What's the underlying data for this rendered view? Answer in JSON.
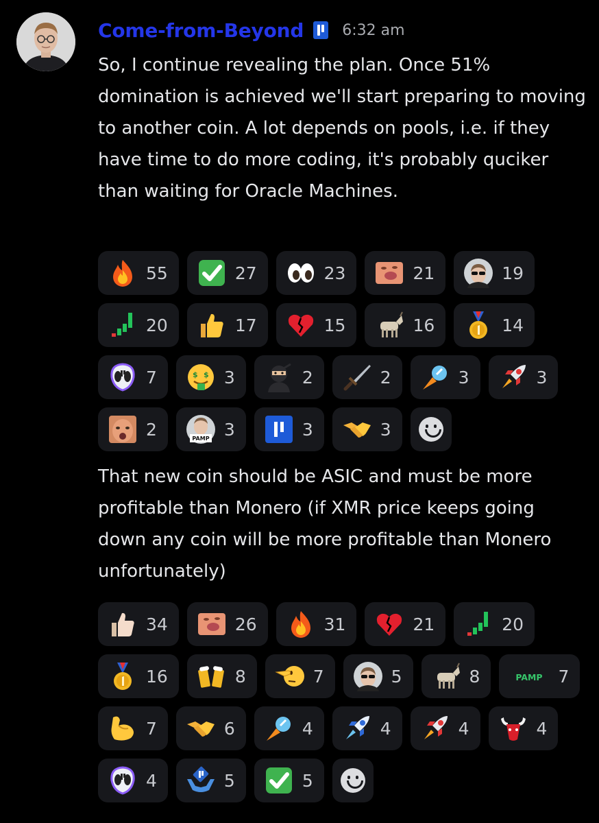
{
  "post": {
    "author": "Come-from-Beyond",
    "time": "6:32 am",
    "avatar_icon": "avatar-photo"
  },
  "message1": "So, I continue revealing the plan. Once 51% domination is achieved we'll start preparing to moving to another coin. A lot depends on pools, i.e. if they have time to do more coding, it's probably quciker than waiting for Oracle Machines.",
  "message2": "That new coin should be ASIC and must be more profitable than Monero (if XMR price keeps going down any coin will be more profitable than Monero unfortunately)",
  "reactions1": {
    "rows": [
      [
        {
          "icon": "fire",
          "count": "55"
        },
        {
          "icon": "check",
          "count": "27"
        },
        {
          "icon": "eyes",
          "count": "23"
        },
        {
          "icon": "face-emote",
          "count": "21"
        },
        {
          "icon": "sunglasses-avatar",
          "count": "19"
        }
      ],
      [
        {
          "icon": "chart-up",
          "count": "20"
        },
        {
          "icon": "thumbs-up",
          "count": "17"
        },
        {
          "icon": "broken-heart",
          "count": "15"
        },
        {
          "icon": "goat",
          "count": "16"
        },
        {
          "icon": "medal",
          "count": "14"
        }
      ],
      [
        {
          "icon": "alien",
          "count": "7"
        },
        {
          "icon": "money-face",
          "count": "3"
        },
        {
          "icon": "ninja",
          "count": "2"
        },
        {
          "icon": "dagger",
          "count": "2"
        },
        {
          "icon": "comet",
          "count": "3"
        },
        {
          "icon": "rocket",
          "count": "3"
        }
      ],
      [
        {
          "icon": "face-photo",
          "count": "2"
        },
        {
          "icon": "pamp-avatar",
          "count": "3"
        },
        {
          "icon": "qubic",
          "count": "3"
        },
        {
          "icon": "handshake",
          "count": "3"
        },
        {
          "icon": "add-reaction",
          "count": ""
        }
      ]
    ]
  },
  "reactions2": {
    "rows": [
      [
        {
          "icon": "thumbs-up-light",
          "count": "34"
        },
        {
          "icon": "face-emote",
          "count": "26"
        },
        {
          "icon": "fire",
          "count": "31"
        },
        {
          "icon": "broken-heart",
          "count": "21"
        },
        {
          "icon": "chart-up",
          "count": "20"
        }
      ],
      [
        {
          "icon": "medal",
          "count": "16"
        },
        {
          "icon": "beers",
          "count": "8"
        },
        {
          "icon": "pointing-face",
          "count": "7"
        },
        {
          "icon": "sunglasses-avatar",
          "count": "5"
        },
        {
          "icon": "goat",
          "count": "8"
        },
        {
          "icon": "pamp-text",
          "count": "7",
          "label": "PAMP"
        }
      ],
      [
        {
          "icon": "flexed-biceps",
          "count": "7"
        },
        {
          "icon": "handshake",
          "count": "6"
        },
        {
          "icon": "comet",
          "count": "4"
        },
        {
          "icon": "rocket-blue",
          "count": "4"
        },
        {
          "icon": "rocket",
          "count": "4"
        },
        {
          "icon": "bull",
          "count": "4"
        }
      ],
      [
        {
          "icon": "alien",
          "count": "4"
        },
        {
          "icon": "qubic-hands",
          "count": "5"
        },
        {
          "icon": "check",
          "count": "5"
        },
        {
          "icon": "add-reaction",
          "count": ""
        }
      ]
    ]
  },
  "colors": {
    "background": "#000000",
    "username": "#2436e8",
    "pill_background": "#17181c",
    "text": "#e6e7ea"
  }
}
